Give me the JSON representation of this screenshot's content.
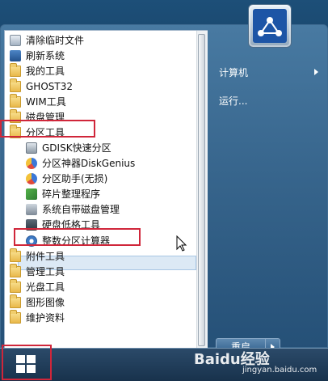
{
  "menu": {
    "items": [
      {
        "label": "清除临时文件",
        "icon": "clean-icon"
      },
      {
        "label": "刷新系统",
        "icon": "refresh-icon"
      },
      {
        "label": "我的工具",
        "icon": "tools-icon"
      },
      {
        "label": "GHOST32",
        "icon": "folder-icon"
      },
      {
        "label": "WIM工具",
        "icon": "folder-icon"
      },
      {
        "label": "磁盘管理",
        "icon": "folder-icon"
      },
      {
        "label": "分区工具",
        "icon": "folder-icon"
      },
      {
        "label": "GDISK快速分区",
        "icon": "disk-icon"
      },
      {
        "label": "分区神器DiskGenius",
        "icon": "pie-icon"
      },
      {
        "label": "分区助手(无损)",
        "icon": "pie-icon"
      },
      {
        "label": "碎片整理程序",
        "icon": "puzzle-icon"
      },
      {
        "label": "系统自带磁盘管理",
        "icon": "sys-icon"
      },
      {
        "label": "硬盘低格工具",
        "icon": "hdd-icon"
      },
      {
        "label": "整数分区计算器",
        "icon": "calculator-icon"
      },
      {
        "label": "附件工具",
        "icon": "folder-icon"
      },
      {
        "label": "管理工具",
        "icon": "folder-icon"
      },
      {
        "label": "光盘工具",
        "icon": "folder-icon"
      },
      {
        "label": "图形图像",
        "icon": "folder-icon"
      },
      {
        "label": "维护资料",
        "icon": "folder-icon"
      }
    ]
  },
  "right": {
    "computer": "计算机",
    "run": "运行..."
  },
  "shutdown": {
    "label": "重启"
  },
  "watermark": {
    "text": "Baidu经验",
    "sub": "jingyan.baidu.com"
  },
  "colors": {
    "highlight": "#d0263a",
    "selected_bg": "#dce9f5"
  }
}
